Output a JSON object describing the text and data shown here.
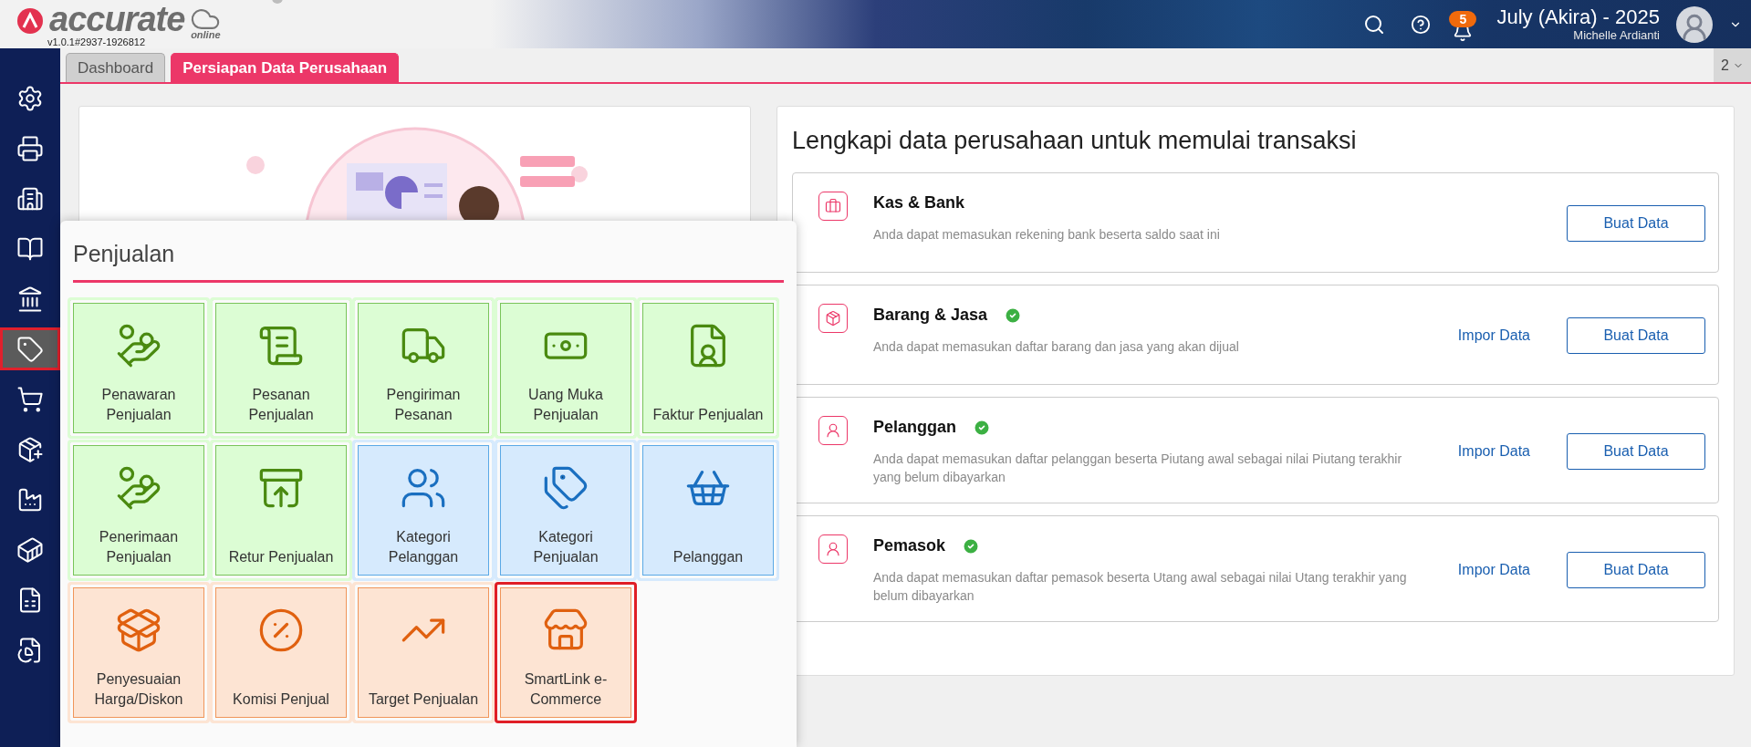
{
  "header": {
    "logo_text": "accurate",
    "logo_sub": "online",
    "version": "v1.0.1#2937-1926812",
    "notifications": "5",
    "period": "July (Akira) - 2025",
    "user": "Michelle Ardianti"
  },
  "tabs": [
    {
      "label": "Dashboard",
      "selected": false
    },
    {
      "label": "Persiapan Data Perusahaan",
      "selected": true
    }
  ],
  "tab_counter": "2",
  "sidebar": {
    "items": [
      {
        "selected": false
      },
      {
        "selected": false
      },
      {
        "selected": false
      },
      {
        "selected": false
      },
      {
        "selected": false
      },
      {
        "selected": true
      },
      {
        "selected": false
      },
      {
        "selected": false
      },
      {
        "selected": false
      },
      {
        "selected": false
      },
      {
        "selected": false
      },
      {
        "selected": false
      }
    ]
  },
  "menu": {
    "title": "Penjualan",
    "tiles": [
      {
        "label": "Penawaran Penjualan",
        "kind": "transaction",
        "highlighted": false
      },
      {
        "label": "Pesanan Penjualan",
        "kind": "transaction",
        "highlighted": false
      },
      {
        "label": "Pengiriman Pesanan",
        "kind": "transaction",
        "highlighted": false
      },
      {
        "label": "Uang Muka Penjualan",
        "kind": "transaction",
        "highlighted": false
      },
      {
        "label": "Faktur Penjualan",
        "kind": "transaction",
        "highlighted": false
      },
      {
        "label": "Penerimaan Penjualan",
        "kind": "transaction",
        "highlighted": false
      },
      {
        "label": "Retur Penjualan",
        "kind": "transaction",
        "highlighted": false
      },
      {
        "label": "Kategori Pelanggan",
        "kind": "master",
        "highlighted": false
      },
      {
        "label": "Kategori Penjualan",
        "kind": "master",
        "highlighted": false
      },
      {
        "label": "Pelanggan",
        "kind": "master",
        "highlighted": false
      },
      {
        "label": "Penyesuaian Harga/Diskon",
        "kind": "other",
        "highlighted": false
      },
      {
        "label": "Komisi Penjual",
        "kind": "other",
        "highlighted": false
      },
      {
        "label": "Target Penjualan",
        "kind": "other",
        "highlighted": false
      },
      {
        "label": "SmartLink e-Commerce",
        "kind": "other",
        "highlighted": true
      }
    ]
  },
  "setup": {
    "title": "Lengkapi data perusahaan untuk memulai transaksi",
    "rows": [
      {
        "title": "Kas & Bank",
        "checked": false,
        "description": "Anda dapat memasukan rekening bank beserta saldo saat ini",
        "create_label": "Buat Data"
      },
      {
        "title": "Barang & Jasa",
        "checked": true,
        "description": "Anda dapat memasukan daftar barang dan jasa yang akan dijual",
        "import_label": "Impor Data",
        "create_label": "Buat Data"
      },
      {
        "title": "Pelanggan",
        "checked": true,
        "description": "Anda dapat memasukan daftar pelanggan beserta Piutang awal sebagai nilai Piutang terakhir yang belum dibayarkan",
        "import_label": "Impor Data",
        "create_label": "Buat Data"
      },
      {
        "title": "Pemasok",
        "checked": true,
        "description": "Anda dapat memasukan daftar pemasok beserta Utang awal sebagai nilai Utang terakhir yang belum dibayarkan",
        "import_label": "Impor Data",
        "create_label": "Buat Data"
      }
    ]
  }
}
